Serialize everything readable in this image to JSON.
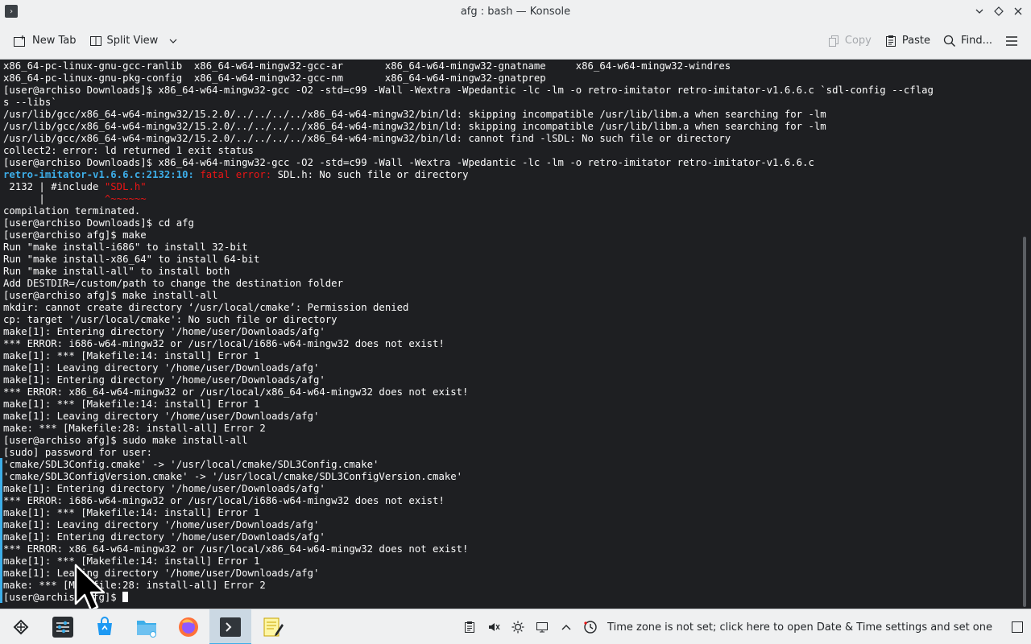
{
  "window": {
    "title": "afg : bash — Konsole"
  },
  "toolbar": {
    "new_tab": "New Tab",
    "split_view": "Split View",
    "copy": "Copy",
    "paste": "Paste",
    "find": "Find..."
  },
  "terminal": {
    "lines": [
      "x86_64-pc-linux-gnu-gcc-ranlib  x86_64-w64-mingw32-gcc-ar       x86_64-w64-mingw32-gnatname     x86_64-w64-mingw32-windres",
      "x86_64-pc-linux-gnu-pkg-config  x86_64-w64-mingw32-gcc-nm       x86_64-w64-mingw32-gnatprep",
      "[user@archiso Downloads]$ x86_64-w64-mingw32-gcc -O2 -std=c99 -Wall -Wextra -Wpedantic -lc -lm -o retro-imitator retro-imitator-v1.6.6.c `sdl-config --cflag",
      "s --libs`",
      "/usr/lib/gcc/x86_64-w64-mingw32/15.2.0/../../../../x86_64-w64-mingw32/bin/ld: skipping incompatible /usr/lib/libm.a when searching for -lm",
      "/usr/lib/gcc/x86_64-w64-mingw32/15.2.0/../../../../x86_64-w64-mingw32/bin/ld: skipping incompatible /usr/lib/libm.a when searching for -lm",
      "/usr/lib/gcc/x86_64-w64-mingw32/15.2.0/../../../../x86_64-w64-mingw32/bin/ld: cannot find -lSDL: No such file or directory",
      "collect2: error: ld returned 1 exit status",
      "[user@archiso Downloads]$ x86_64-w64-mingw32-gcc -O2 -std=c99 -Wall -Wextra -Wpedantic -lc -lm -o retro-imitator retro-imitator-v1.6.6.c",
      "__FATAL__",
      " 2132 | #include __SDLH__",
      "      |          __TILDE__",
      "compilation terminated.",
      "[user@archiso Downloads]$ cd afg",
      "[user@archiso afg]$ make",
      "Run \"make install-i686\" to install 32-bit",
      "Run \"make install-x86_64\" to install 64-bit",
      "Run \"make install-all\" to install both",
      "Add DESTDIR=/custom/path to change the destination folder",
      "[user@archiso afg]$ make install-all",
      "mkdir: cannot create directory ‘/usr/local/cmake’: Permission denied",
      "cp: target '/usr/local/cmake': No such file or directory",
      "make[1]: Entering directory '/home/user/Downloads/afg'",
      "*** ERROR: i686-w64-mingw32 or /usr/local/i686-w64-mingw32 does not exist!",
      "make[1]: *** [Makefile:14: install] Error 1",
      "make[1]: Leaving directory '/home/user/Downloads/afg'",
      "make[1]: Entering directory '/home/user/Downloads/afg'",
      "*** ERROR: x86_64-w64-mingw32 or /usr/local/x86_64-w64-mingw32 does not exist!",
      "make[1]: *** [Makefile:14: install] Error 1",
      "make[1]: Leaving directory '/home/user/Downloads/afg'",
      "make: *** [Makefile:28: install-all] Error 2",
      "[user@archiso afg]$ sudo make install-all",
      "[sudo] password for user:",
      "'cmake/SDL3Config.cmake' -> '/usr/local/cmake/SDL3Config.cmake'",
      "'cmake/SDL3ConfigVersion.cmake' -> '/usr/local/cmake/SDL3ConfigVersion.cmake'",
      "make[1]: Entering directory '/home/user/Downloads/afg'",
      "*** ERROR: i686-w64-mingw32 or /usr/local/i686-w64-mingw32 does not exist!",
      "make[1]: *** [Makefile:14: install] Error 1",
      "make[1]: Leaving directory '/home/user/Downloads/afg'",
      "make[1]: Entering directory '/home/user/Downloads/afg'",
      "*** ERROR: x86_64-w64-mingw32 or /usr/local/x86_64-w64-mingw32 does not exist!",
      "make[1]: *** [Makefile:14: install] Error 1",
      "make[1]: Leaving directory '/home/user/Downloads/afg'",
      "make: *** [Makefile:28: install-all] Error 2",
      "[user@archiso afg]$ "
    ],
    "fatal_file": "retro-imitator-v1.6.6.c:2132:10:",
    "fatal_label": "fatal error:",
    "fatal_msg": " SDL.h: No such file or directory",
    "include_target": "\"SDL.h\"",
    "caret_marker": "^~~~~~~",
    "colors": {
      "background": "#1e1f22",
      "foreground": "#fcfcfc",
      "path_blue": "#3daee9",
      "error_red": "#ed1515",
      "accent_orange": "#f67400"
    }
  },
  "taskbar": {
    "apps": [
      {
        "icon": "app-launcher-icon"
      },
      {
        "icon": "system-settings-icon"
      },
      {
        "icon": "discover-store-icon"
      },
      {
        "icon": "file-manager-icon"
      },
      {
        "icon": "firefox-icon"
      },
      {
        "icon": "konsole-icon"
      },
      {
        "icon": "kate-editor-icon"
      }
    ],
    "tray": {
      "notice": "Time zone is not set; click here to open Date & Time settings and set one"
    }
  }
}
